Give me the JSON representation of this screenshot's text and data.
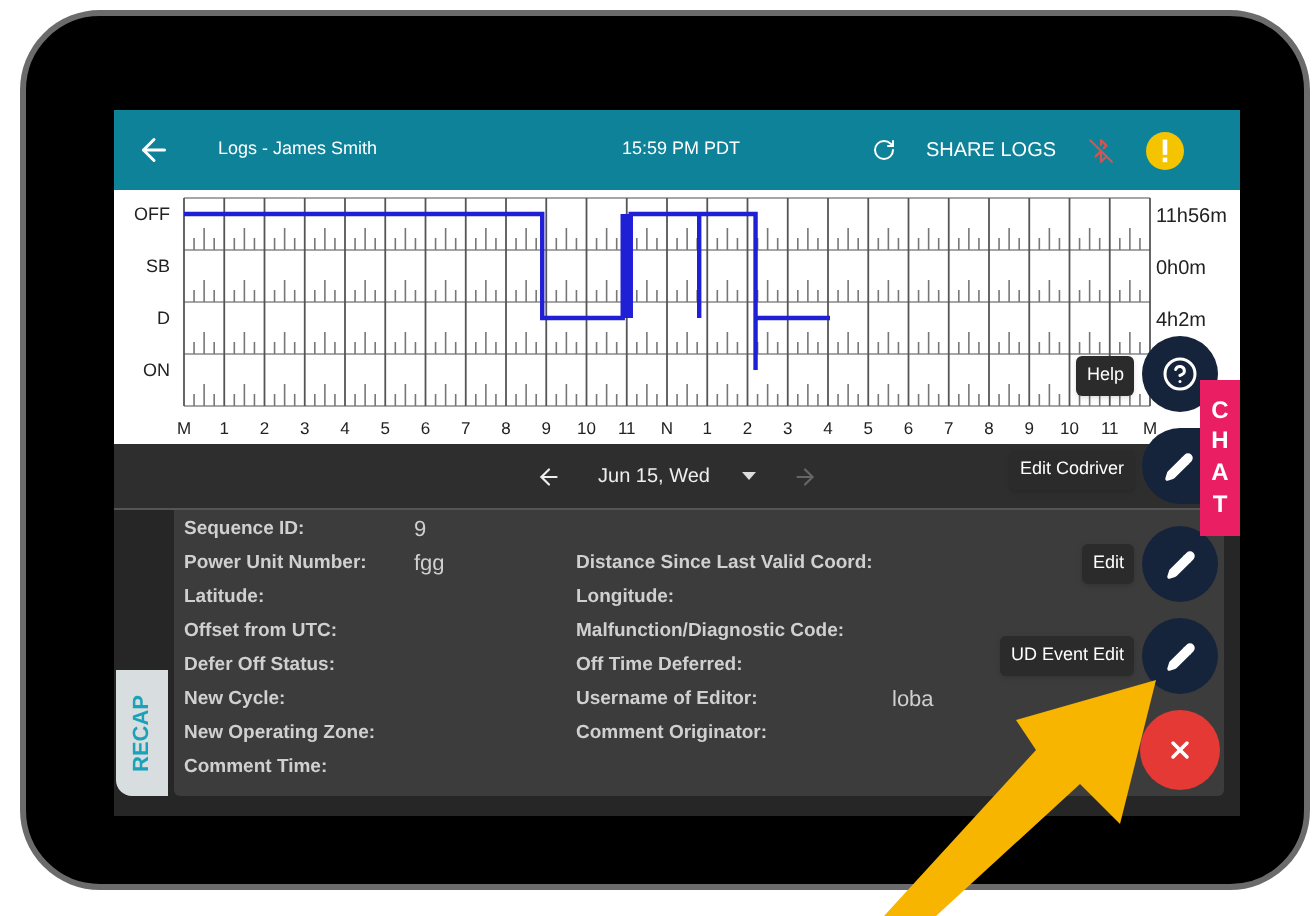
{
  "header": {
    "title": "Logs - James Smith",
    "time": "15:59 PM PDT",
    "share_button": "SHARE LOGS"
  },
  "chart": {
    "status_labels": [
      "OFF",
      "SB",
      "D",
      "ON"
    ],
    "hour_labels": [
      "M",
      "1",
      "2",
      "3",
      "4",
      "5",
      "6",
      "7",
      "8",
      "9",
      "10",
      "11",
      "N",
      "1",
      "2",
      "3",
      "4",
      "5",
      "6",
      "7",
      "8",
      "9",
      "10",
      "11",
      "M"
    ],
    "totals": [
      "11h56m",
      "0h0m",
      "4h2m"
    ]
  },
  "date_nav": {
    "date": "Jun 15, Wed",
    "next_disabled": true
  },
  "details": {
    "tab": "RECAP",
    "left": [
      {
        "label": "Sequence ID:",
        "value": "9"
      },
      {
        "label": "Power Unit Number:",
        "value": "fgg"
      },
      {
        "label": "Latitude:"
      },
      {
        "label": "Offset from UTC:"
      },
      {
        "label": "Defer Off Status:"
      },
      {
        "label": "New Cycle:"
      },
      {
        "label": "New Operating Zone:"
      },
      {
        "label": "Comment Time:"
      }
    ],
    "right": [
      {
        "label": "Distance Since Last Valid Coord:"
      },
      {
        "label": "Longitude:"
      },
      {
        "label": "Malfunction/Diagnostic Code:"
      },
      {
        "label": "Off Time Deferred:"
      },
      {
        "label": "Username of Editor:",
        "value": "loba"
      },
      {
        "label": "Comment Originator:"
      }
    ]
  },
  "fabs": [
    {
      "kind": "help",
      "tooltip": "Help"
    },
    {
      "kind": "edit",
      "tooltip": "Edit Codriver"
    },
    {
      "kind": "edit",
      "tooltip": "Edit"
    },
    {
      "kind": "edit",
      "tooltip": "UD Event Edit"
    },
    {
      "kind": "close"
    }
  ],
  "chat_tab": "CHAT"
}
